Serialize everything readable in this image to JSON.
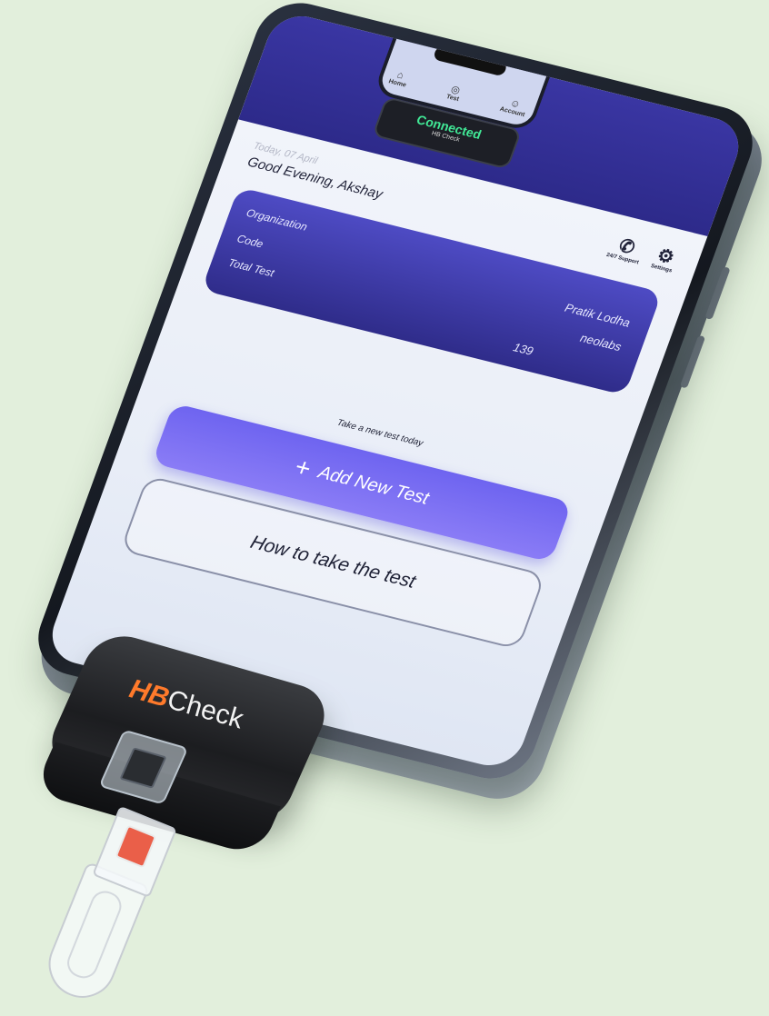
{
  "app": {
    "status": {
      "title": "Connected",
      "subtitle": "HB Check"
    },
    "mini_nav": [
      {
        "label": "Home",
        "icon": "home-icon"
      },
      {
        "label": "Test",
        "icon": "test-icon"
      },
      {
        "label": "Account",
        "icon": "account-icon"
      }
    ],
    "header": {
      "date": "Today, 07 April",
      "greeting": "Good Evening, Akshay",
      "support_label": "24/7 Support",
      "settings_label": "Settings"
    },
    "org_card": {
      "rows": [
        {
          "label": "Organization",
          "value": "Pratik Lodha"
        },
        {
          "label": "Code",
          "value": "neolabs"
        },
        {
          "label": "Total Test",
          "value": "139"
        }
      ]
    },
    "prompt": "Take a new test today",
    "add_button": "Add New Test",
    "how_button": "How to take the test"
  },
  "device": {
    "brand_hb": "HB",
    "brand_check": "Check"
  },
  "colors": {
    "background": "#e2efdc",
    "header": "#2d2a8a",
    "card": "#3f3cae",
    "accent": "#7a6ef3",
    "connected": "#41e896",
    "brand_orange": "#ff7a2b"
  }
}
